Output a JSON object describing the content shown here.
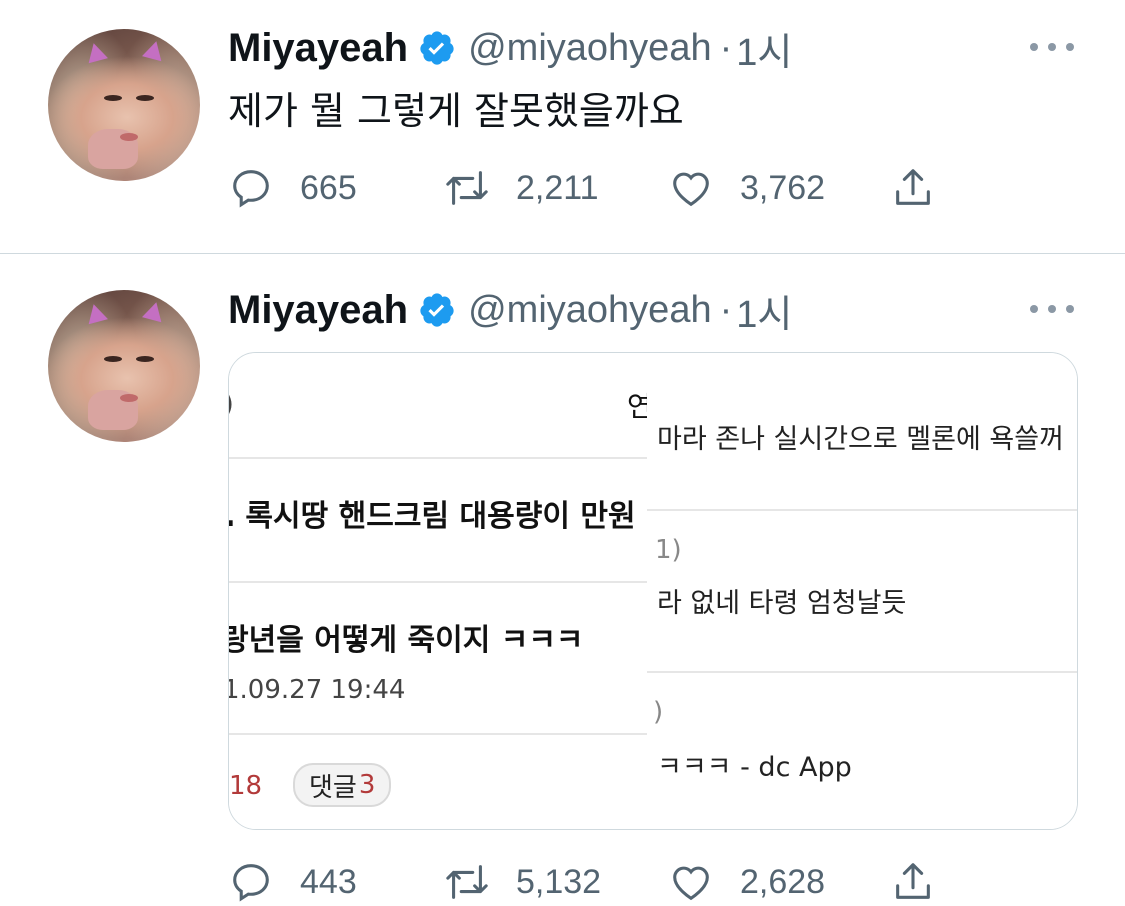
{
  "tweets": [
    {
      "author": {
        "name": "Miyayeah",
        "handle": "@miyaohyeah",
        "separator": "·",
        "time": "1시"
      },
      "text": "제가 뭘 그렇게 잘못했을까요",
      "stats": {
        "replies": "665",
        "retweets": "2,211",
        "likes": "3,762"
      }
    },
    {
      "author": {
        "name": "Miyayeah",
        "handle": "@miyaohyeah",
        "separator": "·",
        "time": "1시"
      },
      "media": {
        "left": {
          "top_fragment_1": ")",
          "top_fragment_2": "연",
          "row1_title": "․ 록시땅 핸드크림 대용량이 만원",
          "row2_title": "랑년을 어떻게 죽이지 ㅋㅋㅋ",
          "row2_date": "1.09.27 19:44",
          "views": "18",
          "comment_label": "댓글",
          "comment_count": "3"
        },
        "right": {
          "line1": "마라 존나 실시간으로 멜론에 욕쓸꺼",
          "line2": "1)",
          "line3": "라 없네 타령 엄청날듯",
          "line4": ")",
          "line5": "ㅋㅋㅋ - dc App"
        }
      },
      "stats": {
        "replies": "443",
        "retweets": "5,132",
        "likes": "2,628"
      }
    }
  ],
  "icons": {
    "verified": "verified-badge-icon",
    "more": "more-dots-icon",
    "reply": "reply-icon",
    "retweet": "retweet-icon",
    "like": "heart-icon",
    "share": "share-icon"
  },
  "colors": {
    "verified": "#1d9bf0",
    "secondary_text": "#536471",
    "divider": "#cfd9de"
  }
}
